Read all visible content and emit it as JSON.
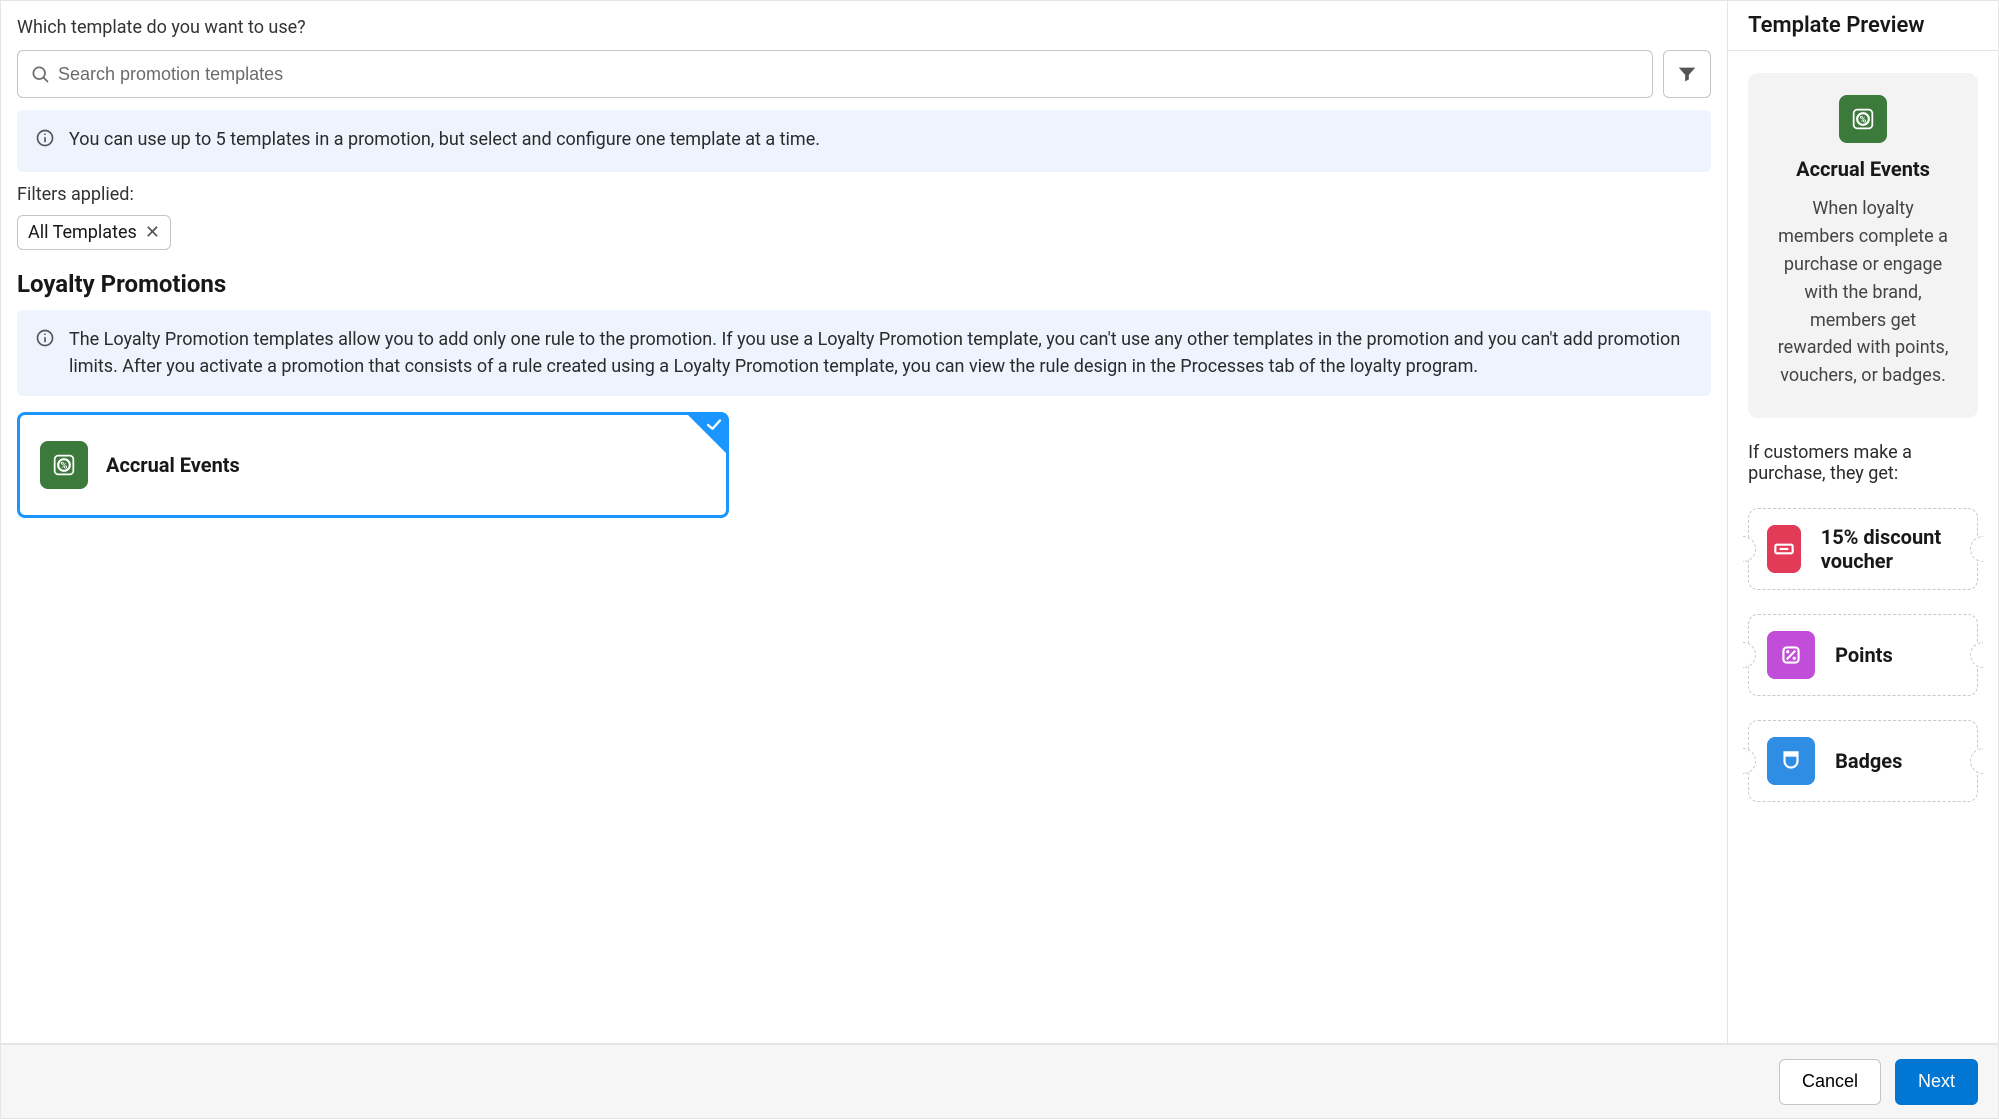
{
  "leftPane": {
    "question": "Which template do you want to use?",
    "search": {
      "placeholder": "Search promotion templates"
    },
    "infoBanner1": "You can use up to 5 templates in a promotion, but select and configure one template at a time.",
    "filtersAppliedLabel": "Filters applied:",
    "chips": [
      {
        "label": "All Templates"
      }
    ],
    "sectionHeading": "Loyalty Promotions",
    "infoBanner2": "The Loyalty Promotion templates allow you to add only one rule to the promotion. If you use a Loyalty Promotion template, you can't use any other templates in the promotion and you can't add promotion limits. After you activate a promotion that consists of a rule created using a Loyalty Promotion template, you can view the rule design in the Processes tab of the loyalty program.",
    "templates": {
      "accrualEvents": {
        "title": "Accrual Events"
      }
    }
  },
  "preview": {
    "header": "Template Preview",
    "title": "Accrual Events",
    "description": "When loyalty members complete a purchase or engage with the brand, members get rewarded with points, vouchers, or badges.",
    "subLabel": "If customers make a purchase, they get:",
    "rewards": {
      "voucher": {
        "title": "15% discount voucher",
        "color": "#e23b57"
      },
      "points": {
        "title": "Points",
        "color": "#c24dd8"
      },
      "badges": {
        "title": "Badges",
        "color": "#2f8de4"
      }
    }
  },
  "footer": {
    "cancel": "Cancel",
    "next": "Next"
  },
  "colors": {
    "accrualIconBg": "#3b7a3b"
  }
}
